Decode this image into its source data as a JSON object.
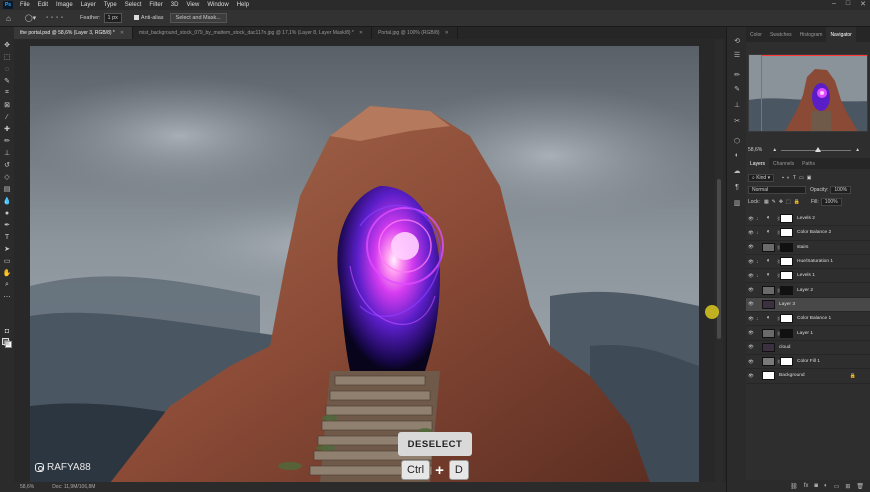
{
  "menu": [
    "File",
    "Edit",
    "Image",
    "Layer",
    "Type",
    "Select",
    "Filter",
    "3D",
    "View",
    "Window",
    "Help"
  ],
  "options": {
    "feather_label": "Feather:",
    "feather_value": "1 px",
    "antialias_label": "Anti-alias",
    "select_mask_label": "Select and Mask..."
  },
  "tabs": [
    {
      "label": "the portal.psd @ 58,6% (Layer 3, RGB/8) *",
      "active": true
    },
    {
      "label": "mist_background_stock_079_by_mattem_stock_dac117n.jpg @ 17,1% (Layer 8, Layer Mask/8) *",
      "active": false
    },
    {
      "label": "Portal.jpg @ 100% (RGB/8)",
      "active": false
    }
  ],
  "status": {
    "zoom": "58,6%",
    "doc": "Doc: 11,9M/106,8M"
  },
  "overlay": {
    "deselect": "DESELECT",
    "key1": "Ctrl",
    "plus": "+",
    "key2": "D"
  },
  "watermark": "RAFYA88",
  "panel": {
    "tabs": [
      "Color",
      "Swatches",
      "Histogram",
      "Navigator"
    ],
    "zoom": "58,6%",
    "layer_tabs": [
      "Layers",
      "Channels",
      "Paths"
    ],
    "filter_kind": "Kind",
    "blend_mode": "Normal",
    "opacity_label": "Opacity:",
    "opacity_value": "100%",
    "lock_label": "Lock:",
    "fill_label": "Fill:",
    "fill_value": "100%"
  },
  "layers": [
    {
      "name": "Levels 2",
      "type": "adj",
      "clip": true,
      "selected": false
    },
    {
      "name": "Color Balance 2",
      "type": "adj",
      "clip": true,
      "selected": false
    },
    {
      "name": "stairs",
      "type": "img-mask",
      "clip": false,
      "selected": false
    },
    {
      "name": "Hue/Saturation 1",
      "type": "adj",
      "clip": true,
      "selected": false
    },
    {
      "name": "Levels 1",
      "type": "adj",
      "clip": true,
      "selected": false
    },
    {
      "name": "Layer 2",
      "type": "img-mask",
      "clip": false,
      "selected": false
    },
    {
      "name": "Layer 3",
      "type": "img",
      "clip": false,
      "selected": true
    },
    {
      "name": "Color Balance 1",
      "type": "adj",
      "clip": true,
      "selected": false
    },
    {
      "name": "Layer 1",
      "type": "img-mask",
      "clip": false,
      "selected": false
    },
    {
      "name": "cloud",
      "type": "img",
      "clip": false,
      "selected": false
    },
    {
      "name": "Color Fill 1",
      "type": "fill",
      "clip": false,
      "selected": false
    },
    {
      "name": "Background",
      "type": "bg",
      "clip": false,
      "selected": false,
      "locked": true
    }
  ],
  "colors": {
    "portal_glow": "#e04cff",
    "portal_core": "#ffd0ff",
    "rock": "#8a4a36",
    "sky": "#8a929a",
    "accent_red": "#ff3b3b"
  }
}
